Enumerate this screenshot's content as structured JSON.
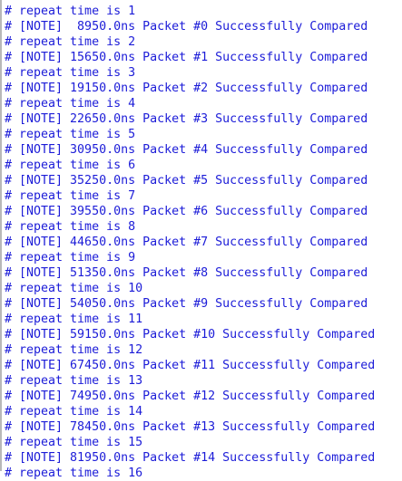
{
  "log": {
    "lines": [
      "# repeat time is 1",
      "# [NOTE]  8950.0ns Packet #0 Successfully Compared",
      "# repeat time is 2",
      "# [NOTE] 15650.0ns Packet #1 Successfully Compared",
      "# repeat time is 3",
      "# [NOTE] 19150.0ns Packet #2 Successfully Compared",
      "# repeat time is 4",
      "# [NOTE] 22650.0ns Packet #3 Successfully Compared",
      "# repeat time is 5",
      "# [NOTE] 30950.0ns Packet #4 Successfully Compared",
      "# repeat time is 6",
      "# [NOTE] 35250.0ns Packet #5 Successfully Compared",
      "# repeat time is 7",
      "# [NOTE] 39550.0ns Packet #6 Successfully Compared",
      "# repeat time is 8",
      "# [NOTE] 44650.0ns Packet #7 Successfully Compared",
      "# repeat time is 9",
      "# [NOTE] 51350.0ns Packet #8 Successfully Compared",
      "# repeat time is 10",
      "# [NOTE] 54050.0ns Packet #9 Successfully Compared",
      "# repeat time is 11",
      "# [NOTE] 59150.0ns Packet #10 Successfully Compared",
      "# repeat time is 12",
      "# [NOTE] 67450.0ns Packet #11 Successfully Compared",
      "# repeat time is 13",
      "# [NOTE] 74950.0ns Packet #12 Successfully Compared",
      "# repeat time is 14",
      "# [NOTE] 78450.0ns Packet #13 Successfully Compared",
      "# repeat time is 15",
      "# [NOTE] 81950.0ns Packet #14 Successfully Compared",
      "# repeat time is 16"
    ]
  }
}
